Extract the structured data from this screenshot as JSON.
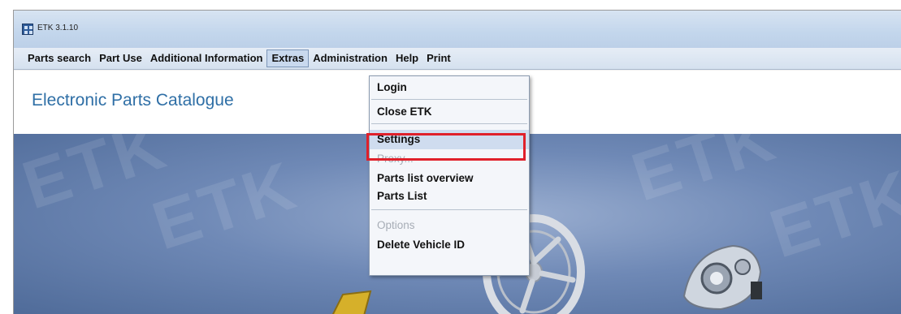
{
  "window": {
    "title": "ETK 3.1.10"
  },
  "menubar": {
    "items": [
      {
        "label": "Parts search"
      },
      {
        "label": "Part Use"
      },
      {
        "label": "Additional Information"
      },
      {
        "label": "Extras"
      },
      {
        "label": "Administration"
      },
      {
        "label": "Help"
      },
      {
        "label": "Print"
      }
    ]
  },
  "header": {
    "title": "Electronic Parts Catalogue"
  },
  "extras_menu": {
    "items": [
      {
        "label": "Login",
        "enabled": true
      },
      {
        "label": "Close ETK",
        "enabled": true
      },
      {
        "label": "Settings",
        "enabled": true,
        "highlighted": true
      },
      {
        "label": "Proxy...",
        "enabled": false
      },
      {
        "label": "Parts list overview",
        "enabled": true
      },
      {
        "label": "Parts List",
        "enabled": true
      },
      {
        "label": "Options",
        "enabled": false
      },
      {
        "label": "Delete Vehicle ID",
        "enabled": true
      }
    ]
  },
  "colors": {
    "title_blue": "#2f6fa6",
    "highlight_red": "#e0202a",
    "stage_blue": "#6f89b6"
  }
}
